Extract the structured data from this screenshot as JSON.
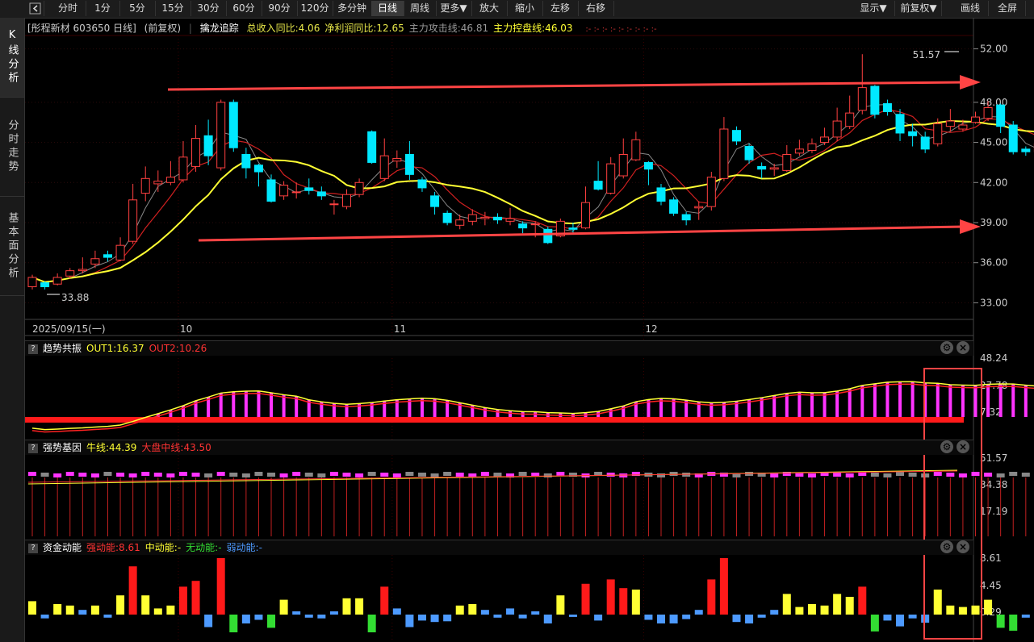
{
  "toolbar": {
    "periods": [
      "分时",
      "1分",
      "5分",
      "15分",
      "30分",
      "60分",
      "90分",
      "120分",
      "多分钟",
      "日线",
      "周线",
      "更多▼",
      "放大",
      "缩小",
      "左移",
      "右移"
    ],
    "active_period": "日线",
    "right": [
      "显示▼",
      "前复权▼",
      "画线",
      "全屏"
    ]
  },
  "sidebar": {
    "tabs": [
      "K线分析",
      "分时走势",
      "基本面分析"
    ],
    "active": "K线分析"
  },
  "main": {
    "stock_label": "[彤程新材 603650 日线]",
    "adjust_label": "(前复权)",
    "indicator_name": "擒龙追踪",
    "fields": [
      {
        "text": "总收入同比:4.06",
        "color": "#e8e84a"
      },
      {
        "text": "净利润同比:12.65",
        "color": "#e8e84a"
      },
      {
        "text": "主力攻击线:46.81",
        "color": "#9a9a9a"
      },
      {
        "text": "主力控盘线:46.03",
        "color": "#ffff33"
      }
    ],
    "extra_marks": ":- :- :- :- :- :- :- :- :-",
    "high_label": "51.57",
    "low_label": "33.88",
    "price_ticks": [
      "52.00",
      "48.00",
      "45.00",
      "42.00",
      "39.00",
      "36.00",
      "33.00"
    ],
    "date_labels": [
      "2025/09/15(一)",
      "10",
      "11",
      "12"
    ]
  },
  "panels": [
    {
      "title": "趋势共振",
      "fields": [
        {
          "text": "OUT1:16.37",
          "color": "#ffff33"
        },
        {
          "text": "OUT2:10.26",
          "color": "#ff3333"
        }
      ],
      "ticks": [
        "48.24",
        "27.78",
        "7.32"
      ]
    },
    {
      "title": "强势基因",
      "fields": [
        {
          "text": "牛线:44.39",
          "color": "#ffff33"
        },
        {
          "text": "大盘中线:43.50",
          "color": "#ff3333"
        }
      ],
      "ticks": [
        "51.57",
        "34.38",
        "17.19"
      ]
    },
    {
      "title": "资金动能",
      "fields": [
        {
          "text": "强动能:8.61",
          "color": "#ff3333"
        },
        {
          "text": "中动能:-",
          "color": "#ffff33"
        },
        {
          "text": "无动能:-",
          "color": "#33dd33"
        },
        {
          "text": "弱动能:-",
          "color": "#4d9aff"
        }
      ],
      "ticks": [
        "8.61",
        "4.45",
        "0.29"
      ]
    }
  ],
  "chart_data": {
    "type": "candlestick",
    "ylim": [
      32,
      53
    ],
    "candles": [
      [
        34.2,
        34.9,
        35.1,
        34.0
      ],
      [
        34.5,
        34.2,
        34.6,
        34.0
      ],
      [
        34.4,
        34.9,
        35.2,
        34.3
      ],
      [
        35.0,
        35.4,
        35.6,
        34.8
      ],
      [
        35.4,
        35.5,
        36.4,
        35.2
      ],
      [
        35.9,
        36.3,
        36.9,
        35.6
      ],
      [
        36.6,
        36.4,
        36.9,
        36.1
      ],
      [
        36.2,
        37.3,
        37.9,
        36.1
      ],
      [
        37.6,
        40.7,
        41.9,
        37.4
      ],
      [
        41.2,
        42.3,
        43.2,
        40.6
      ],
      [
        41.9,
        42.1,
        42.9,
        41.3
      ],
      [
        42.0,
        42.4,
        43.6,
        41.8
      ],
      [
        42.2,
        43.9,
        45.1,
        42.0
      ],
      [
        43.2,
        45.3,
        46.3,
        42.8
      ],
      [
        45.5,
        44.0,
        46.7,
        43.3
      ],
      [
        43.1,
        48.0,
        48.2,
        42.9
      ],
      [
        48.0,
        44.6,
        48.2,
        44.3
      ],
      [
        44.1,
        43.1,
        44.6,
        42.3
      ],
      [
        43.3,
        42.8,
        43.4,
        41.7
      ],
      [
        42.2,
        40.6,
        42.6,
        40.5
      ],
      [
        41.0,
        41.8,
        42.1,
        40.7
      ],
      [
        41.3,
        41.3,
        42.0,
        40.8
      ],
      [
        41.6,
        41.4,
        42.3,
        41.1
      ],
      [
        41.3,
        41.0,
        41.7,
        40.7
      ],
      [
        40.4,
        40.4,
        40.7,
        39.6
      ],
      [
        40.2,
        41.1,
        41.5,
        40.0
      ],
      [
        41.1,
        42.0,
        42.3,
        40.9
      ],
      [
        45.8,
        43.5,
        45.9,
        43.4
      ],
      [
        42.3,
        44.0,
        45.3,
        42.1
      ],
      [
        43.6,
        43.8,
        44.4,
        43.1
      ],
      [
        44.1,
        42.6,
        45.1,
        42.2
      ],
      [
        42.2,
        41.6,
        42.4,
        41.3
      ],
      [
        41.0,
        40.2,
        41.3,
        39.6
      ],
      [
        39.7,
        39.0,
        39.9,
        38.8
      ],
      [
        38.8,
        39.2,
        39.6,
        38.5
      ],
      [
        39.1,
        39.6,
        40.0,
        38.8
      ],
      [
        39.3,
        39.4,
        39.8,
        38.8
      ],
      [
        39.4,
        39.2,
        39.7,
        38.9
      ],
      [
        39.1,
        39.3,
        40.1,
        38.8
      ],
      [
        38.9,
        38.6,
        39.1,
        38.2
      ],
      [
        38.9,
        38.9,
        39.1,
        37.9
      ],
      [
        38.5,
        37.5,
        38.7,
        37.4
      ],
      [
        38.0,
        39.1,
        39.3,
        37.9
      ],
      [
        38.6,
        38.5,
        39.0,
        38.2
      ],
      [
        38.6,
        40.5,
        41.7,
        38.5
      ],
      [
        42.1,
        41.5,
        43.6,
        41.4
      ],
      [
        41.2,
        43.4,
        43.9,
        41.1
      ],
      [
        42.5,
        44.1,
        45.3,
        42.3
      ],
      [
        43.7,
        45.2,
        45.8,
        43.6
      ],
      [
        43.5,
        43.0,
        43.6,
        41.8
      ],
      [
        41.6,
        40.6,
        41.9,
        40.3
      ],
      [
        40.7,
        39.7,
        40.9,
        39.5
      ],
      [
        39.6,
        39.2,
        39.8,
        38.8
      ],
      [
        40.1,
        40.2,
        40.6,
        39.2
      ],
      [
        40.2,
        42.4,
        42.8,
        39.9
      ],
      [
        42.3,
        46.0,
        46.9,
        42.1
      ],
      [
        45.9,
        45.1,
        46.2,
        44.8
      ],
      [
        44.7,
        43.7,
        44.9,
        43.4
      ],
      [
        43.2,
        43.0,
        43.5,
        42.3
      ],
      [
        43.0,
        43.1,
        43.4,
        42.5
      ],
      [
        42.9,
        44.1,
        44.8,
        42.8
      ],
      [
        44.2,
        44.5,
        45.2,
        44.0
      ],
      [
        44.4,
        44.9,
        45.3,
        44.2
      ],
      [
        45.0,
        45.4,
        46.1,
        44.8
      ],
      [
        45.4,
        46.6,
        47.6,
        45.1
      ],
      [
        46.2,
        47.2,
        48.5,
        46.0
      ],
      [
        47.4,
        49.1,
        51.6,
        47.1
      ],
      [
        49.2,
        47.1,
        49.3,
        46.8
      ],
      [
        47.9,
        47.3,
        48.2,
        47.0
      ],
      [
        47.1,
        45.7,
        47.5,
        45.1
      ],
      [
        45.8,
        45.5,
        46.4,
        44.7
      ],
      [
        45.4,
        44.5,
        45.8,
        44.2
      ],
      [
        44.9,
        46.4,
        46.8,
        44.7
      ],
      [
        46.2,
        46.6,
        47.5,
        45.8
      ],
      [
        46.0,
        46.3,
        46.7,
        45.8
      ],
      [
        46.5,
        46.9,
        47.3,
        46.4
      ],
      [
        46.8,
        47.6,
        48.1,
        46.6
      ],
      [
        47.8,
        46.2,
        47.9,
        45.7
      ],
      [
        46.3,
        44.3,
        46.6,
        44.1
      ],
      [
        44.5,
        44.3,
        44.7,
        44.0
      ],
      [
        44.3,
        44.9,
        45.2,
        44.0
      ],
      [
        44.9,
        44.2,
        45.2,
        43.9
      ],
      [
        44.2,
        45.1,
        46.0,
        44.1
      ],
      [
        45.4,
        47.1,
        47.4,
        45.2
      ]
    ]
  }
}
